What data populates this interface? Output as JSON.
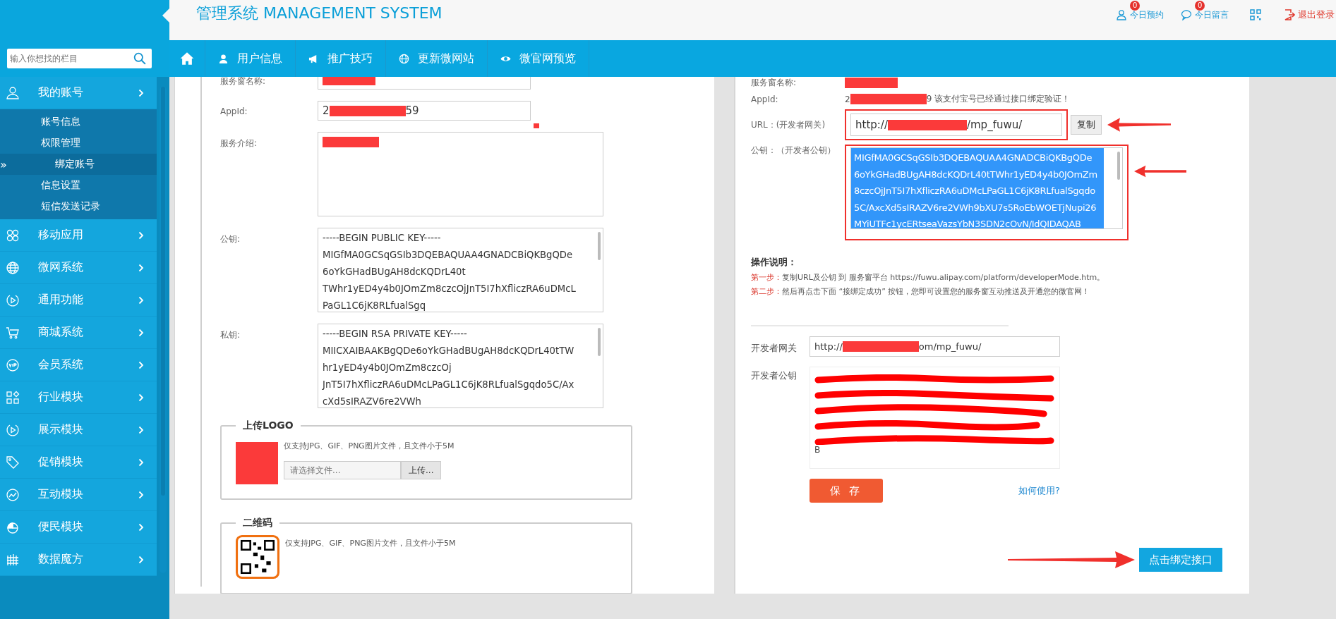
{
  "header": {
    "title": "管理系统 MANAGEMENT SYSTEM",
    "actions": [
      {
        "label": "今日预约",
        "badge": "0"
      },
      {
        "label": "今日留言",
        "badge": "0"
      }
    ],
    "logout": "退出登录"
  },
  "search": {
    "placeholder": "输入你想找的栏目"
  },
  "nav": [
    "用户信息",
    "推广技巧",
    "更新微网站",
    "微官网预览"
  ],
  "sidebar": {
    "items": [
      {
        "label": "我的账号",
        "children": [
          {
            "label": "账号信息",
            "selected": false
          },
          {
            "label": "权限管理",
            "selected": false
          },
          {
            "label": "绑定账号",
            "selected": true,
            "marker": "»"
          },
          {
            "label": "信息设置",
            "selected": false
          },
          {
            "label": "短信发送记录",
            "selected": false
          }
        ]
      },
      {
        "label": "移动应用"
      },
      {
        "label": "微网系统"
      },
      {
        "label": "通用功能"
      },
      {
        "label": "商城系统"
      },
      {
        "label": "会员系统"
      },
      {
        "label": "行业模块"
      },
      {
        "label": "展示模块"
      },
      {
        "label": "促销模块"
      },
      {
        "label": "互动模块"
      },
      {
        "label": "便民模块"
      },
      {
        "label": "数据魔方"
      }
    ]
  },
  "service_form": {
    "name_label": "服务窗名称:",
    "appid": {
      "label": "AppId:",
      "value_start": "2",
      "value_end": "59"
    },
    "intro_label": "服务介绍:",
    "public_key": {
      "label": "公钥:",
      "value": "-----BEGIN PUBLIC KEY-----\nMIGfMA0GCSqGSIb3DQEBAQUAA4GNADCBiQKBgQDe\n6oYkGHadBUgAH8dcKQDrL40t\nTWhr1yED4y4b0JOmZm8czcOjJnT5I7hXfliczRA6uDMcL\nPaGL1C6jK8RLfualSgq"
    },
    "private_key": {
      "label": "私钥:",
      "value": "-----BEGIN RSA PRIVATE KEY-----\nMIICXAIBAAKBgQDe6oYkGHadBUgAH8dcKQDrL40tTW\nhr1yED4y4b0JOmZm8czcOj\nJnT5I7hXfliczRA6uDMcLPaGL1C6jK8RLfualSgqdo5C/Ax\ncXd5sIRAZV6re2VWh"
    },
    "uploads": [
      {
        "kind": "logo",
        "title": "上传LOGO",
        "hint": "仅支持JPG、GIF、PNG图片文件，且文件小于5M",
        "placeholder": "请选择文件...",
        "button": "上传..."
      },
      {
        "kind": "qrcode",
        "title": "二维码",
        "hint": "仅支持JPG、GIF、PNG图片文件，且文件小于5M"
      }
    ]
  },
  "binding": {
    "name_label": "服务窗名称:",
    "appid": {
      "label": "AppId:",
      "value_start": "2",
      "value_end": "9",
      "note": "该支付宝号已经通过接口绑定验证！"
    },
    "url": {
      "label": "URL：(开发者网关)",
      "value_start": "http://",
      "value_end": "/mp_fuwu/",
      "button": "复制"
    },
    "public_key": {
      "label": "公钥：（开发者公钥）",
      "selected": true,
      "value": "MIGfMA0GCSqGSIb3DQEBAQUAA4GNADCBiQKBgQDe\n6oYkGHadBUgAH8dcKQDrL40tTWhr1yED4y4b0JOmZm\n8czcOjJnT5I7hXfliczRA6uDMcLPaGL1C6jK8RLfualSgqdo\n5C/AxcXd5sIRAZV6re2VWh9bXU7s5RoEbWOETjNupi26\nMYiUTFc1ycERtseaVazsYbN3SDN2cOvN/IdQIDAQAB"
    },
    "instructions": {
      "title": "操作说明：",
      "steps": [
        {
          "step": "第一步：",
          "text": "复制URL及公钥 到 服务窗平台 https://fuwu.alipay.com/platform/developerMode.htm。"
        },
        {
          "step": "第二步：",
          "text": "然后再点击下面 “接绑定成功” 按钮，您即可设置您的服务窗互动推送及开通您的微官网！"
        }
      ]
    },
    "gateway": {
      "label": "开发者网关",
      "value_start": "http://",
      "value_end": "om/mp_fuwu/"
    },
    "dev_key": {
      "label": "开发者公钥",
      "visible_end": "B"
    },
    "save": "保 存",
    "help_link": "如何使用?",
    "bind_button": "点击绑定接口"
  }
}
